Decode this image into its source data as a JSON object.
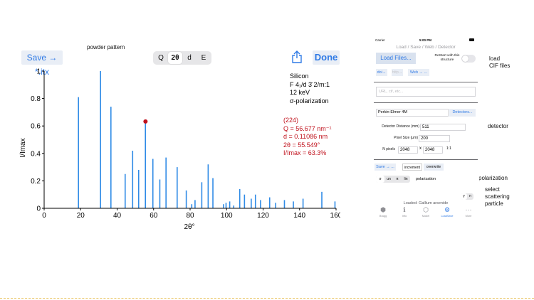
{
  "captions": {
    "powder_pattern": "powder pattern",
    "load_cif": [
      "load",
      "CIF files"
    ],
    "detector": "detector",
    "polarization": "polarization",
    "select_particle": [
      "select",
      "scattering",
      "particle"
    ]
  },
  "toolbar": {
    "save_label": "Save → *.itx",
    "modes": [
      "Q",
      "2θ",
      "d",
      "E"
    ],
    "active_mode": "2θ",
    "done_label": "Done",
    "share_icon": "share-icon"
  },
  "info_box": [
    "Silicon",
    "F 4₁/d 3̄ 2/m:1",
    "12 keV",
    "σ-polarization"
  ],
  "selected_peak": [
    "(224)",
    "Q = 56.677 nm⁻¹",
    "d = 0.11086 nm",
    "2θ = 55.549°",
    "I/Imax = 63.3%"
  ],
  "chart_data": {
    "type": "bar",
    "xlabel": "2θ°",
    "ylabel": "I/Imax",
    "xlim": [
      0,
      160
    ],
    "ylim": [
      0,
      1
    ],
    "xticks": [
      0,
      20,
      40,
      60,
      80,
      100,
      120,
      140,
      160
    ],
    "yticks": [
      0,
      0.2,
      0.4,
      0.6,
      0.8,
      1
    ],
    "bar_color": "#2f8be6",
    "marker": {
      "x": 55.549,
      "y": 0.633,
      "color": "#c0111c"
    },
    "x": [
      18.8,
      30.9,
      36.6,
      44.4,
      48.5,
      51.8,
      55.5,
      59.6,
      63.4,
      66.8,
      72.9,
      77.9,
      80.9,
      82.7,
      86.4,
      89.9,
      92.5,
      98.3,
      99.7,
      101.7,
      103.9,
      107.2,
      109.8,
      113.5,
      115.8,
      118.6,
      123.6,
      126.9,
      131.7,
      136.6,
      141.9,
      152.2,
      159.4
    ],
    "y": [
      0.81,
      1.0,
      0.74,
      0.25,
      0.42,
      0.28,
      0.633,
      0.36,
      0.21,
      0.37,
      0.3,
      0.13,
      0.03,
      0.06,
      0.19,
      0.32,
      0.22,
      0.03,
      0.04,
      0.05,
      0.02,
      0.14,
      0.1,
      0.07,
      0.1,
      0.06,
      0.08,
      0.04,
      0.06,
      0.05,
      0.07,
      0.12,
      0.05
    ]
  },
  "phone": {
    "carrier": "Carrier",
    "time": "5:00 PM",
    "title": "Load / Save / Web / Detector",
    "load_files": "Load Files...",
    "restart": "ReStart with this structure",
    "links": [
      "doi→",
      "http→",
      "Web → ..."
    ],
    "url_placeholder": "URL, cif, etc...",
    "detector_name": "Perkin-Elmer 4M",
    "detectors_btn": "Detectors...",
    "dist_label": "Detector Distance (mm)",
    "dist_value": "511",
    "pixel_label": "Pixel Size (μm)",
    "pixel_value": "200",
    "npix_label": "N pixels",
    "npix_x": "2048",
    "npix_sep": "x",
    "npix_y": "2048",
    "npix_ratio": "1:1",
    "save_link": "Save → ...",
    "increment": "increment",
    "overwrite": "overwrite",
    "pol_options": [
      "σ",
      "un",
      "π",
      "lin"
    ],
    "pol_label": "polarization",
    "particle_options": [
      "γ",
      "n"
    ],
    "loaded": "Loaded: Gallium arsenide",
    "tabs": [
      {
        "label": "Bragg",
        "icon": "hexagon-icon"
      },
      {
        "label": "Info",
        "icon": "info-icon"
      },
      {
        "label": "Model",
        "icon": "cube-icon"
      },
      {
        "label": "LoadSave",
        "icon": "gear-icon"
      },
      {
        "label": "More",
        "icon": "more-icon"
      }
    ]
  }
}
